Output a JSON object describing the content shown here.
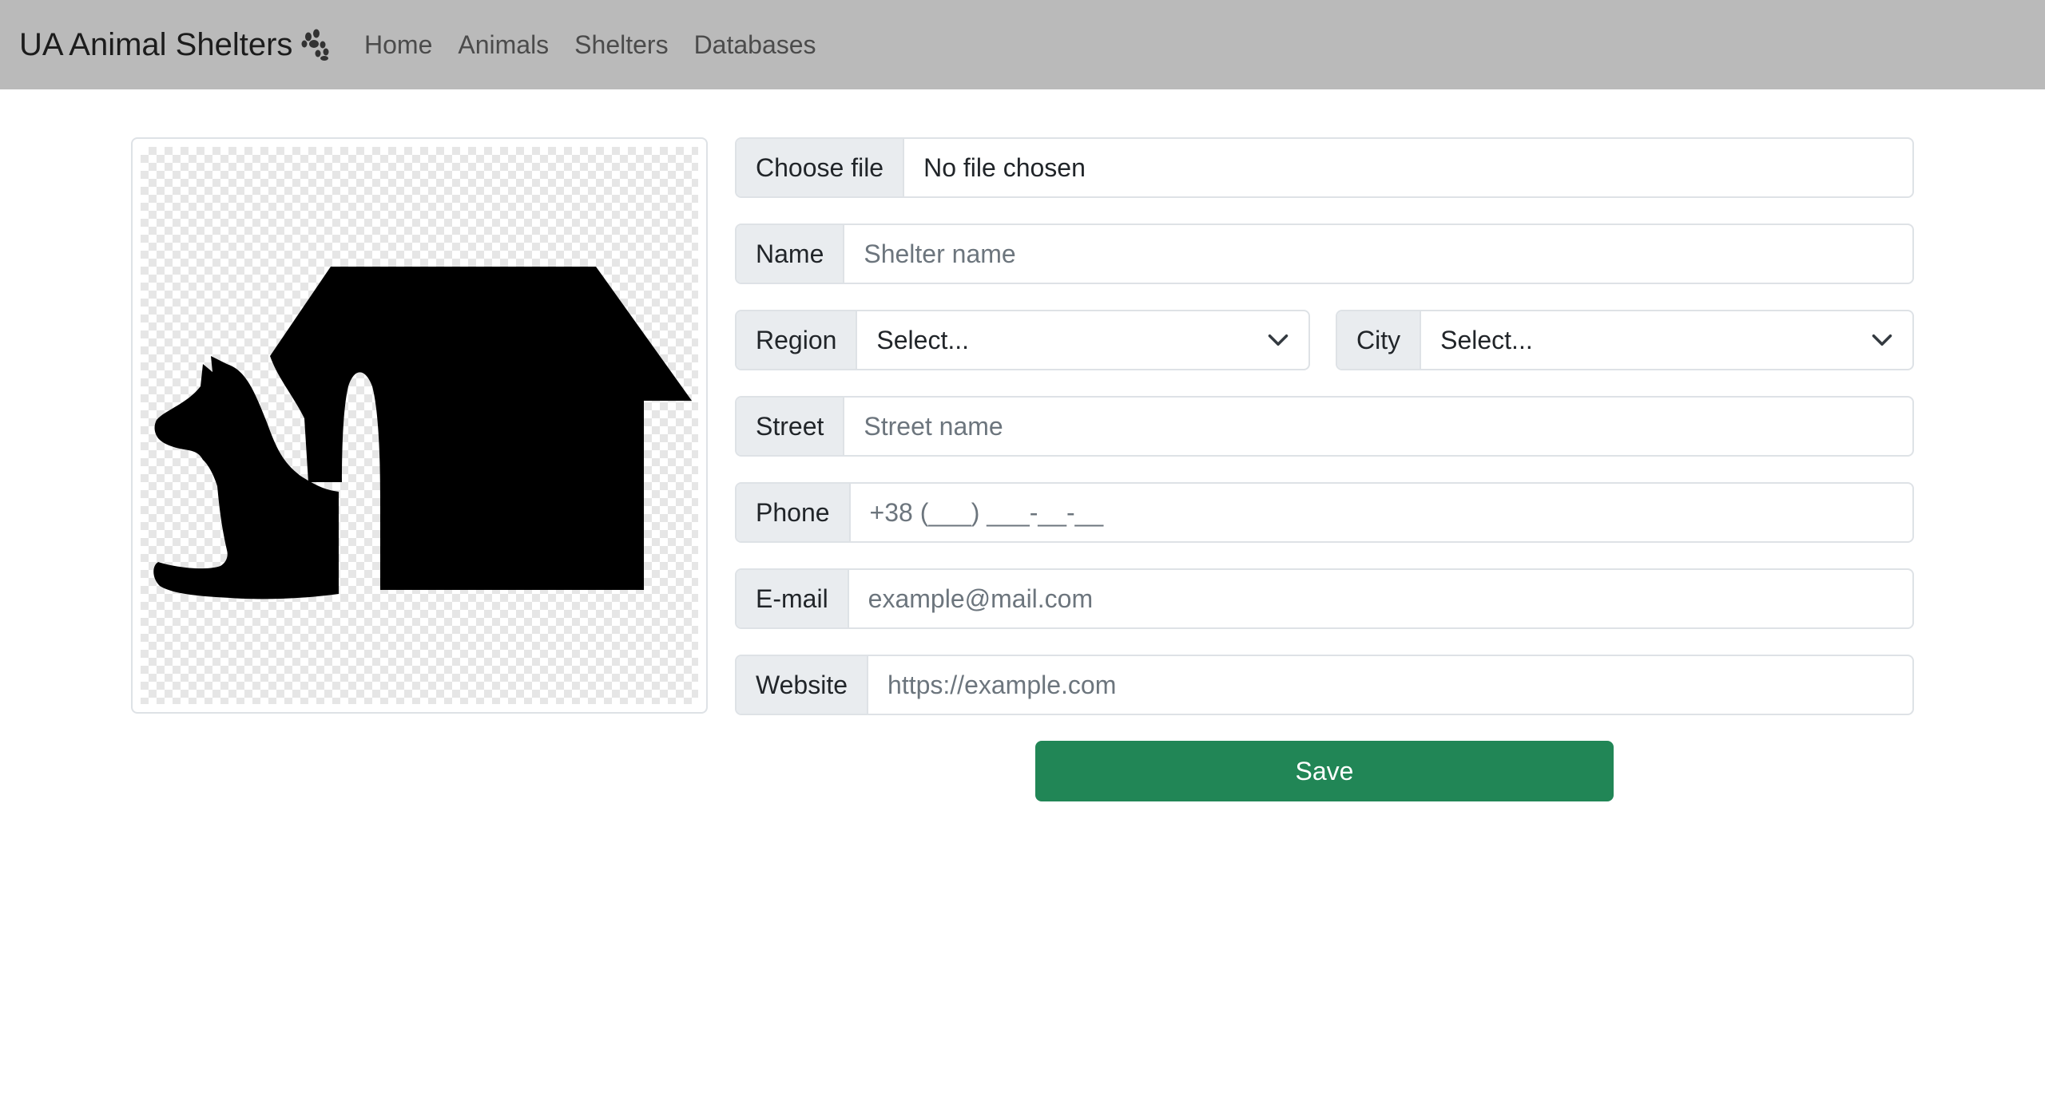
{
  "nav": {
    "brand": "UA Animal Shelters",
    "brand_icon": "paw-icon",
    "links": [
      {
        "label": "Home"
      },
      {
        "label": "Animals"
      },
      {
        "label": "Shelters"
      },
      {
        "label": "Databases"
      }
    ]
  },
  "image_preview": {
    "icon": "dog-house-icon"
  },
  "form": {
    "file": {
      "button_label": "Choose file",
      "status": "No file chosen"
    },
    "name": {
      "label": "Name",
      "placeholder": "Shelter name",
      "value": ""
    },
    "region": {
      "label": "Region",
      "selected": "Select..."
    },
    "city": {
      "label": "City",
      "selected": "Select..."
    },
    "street": {
      "label": "Street",
      "placeholder": "Street name",
      "value": ""
    },
    "phone": {
      "label": "Phone",
      "placeholder": "+38 (___) ___-__-__",
      "value": ""
    },
    "email": {
      "label": "E-mail",
      "placeholder": "example@mail.com",
      "value": ""
    },
    "website": {
      "label": "Website",
      "placeholder": "https://example.com",
      "value": ""
    },
    "save_label": "Save"
  },
  "colors": {
    "navbar_bg": "#bababa",
    "save_button": "#218656"
  }
}
